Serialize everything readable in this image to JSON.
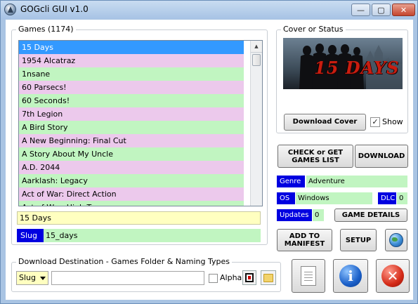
{
  "window": {
    "title": "GOGcli GUI v1.0",
    "minimize_glyph": "—",
    "maximize_glyph": "▢",
    "close_glyph": "✕"
  },
  "games": {
    "legend": "Games  (1174)",
    "items": [
      "15 Days",
      "1954 Alcatraz",
      "1nsane",
      "60 Parsecs!",
      "60 Seconds!",
      "7th Legion",
      "A Bird Story",
      "A New Beginning: Final Cut",
      "A Story About My Uncle",
      "A.D. 2044",
      "Aarklash: Legacy",
      "Act of War: Direct Action",
      "Act of War: High Treason"
    ],
    "selected_index": 0,
    "selected_title": "15 Days",
    "slug_label": "Slug",
    "slug_value": "15_days"
  },
  "destination": {
    "legend": "Download Destination - Games Folder & Naming Types",
    "naming_value": "Slug",
    "folder_value": "",
    "alpha_label": "Alpha",
    "alpha_checked": false
  },
  "cover": {
    "legend": "Cover or Status",
    "image_caption": "15 DAYS",
    "download_label": "Download Cover",
    "show_label": "Show",
    "show_checked": true,
    "show_mark": "✓"
  },
  "actions": {
    "check_list_label": "CHECK or GET GAMES LIST",
    "download_label": "DOWNLOAD",
    "add_manifest_label": "ADD TO MANIFEST",
    "setup_label": "SETUP",
    "game_details_label": "GAME DETAILS"
  },
  "details": {
    "genre_label": "Genre",
    "genre_value": "Adventure",
    "os_label": "OS",
    "os_value": "Windows",
    "dlc_label": "DLC",
    "dlc_value": "0",
    "updates_label": "Updates",
    "updates_value": "0"
  },
  "icons": {
    "app": "gogcli-logo-icon",
    "globe": "globe-icon",
    "notes": "notes-document-icon",
    "info": "info-icon",
    "exit": "exit-icon",
    "rename": "rename-icon",
    "folder": "folder-icon"
  },
  "colors": {
    "list_pink": "#ecc9ec",
    "list_green": "#c1f5c1",
    "selection_blue": "#3399ff",
    "label_blue": "#0000e0",
    "field_yellow": "#ffffc0"
  }
}
